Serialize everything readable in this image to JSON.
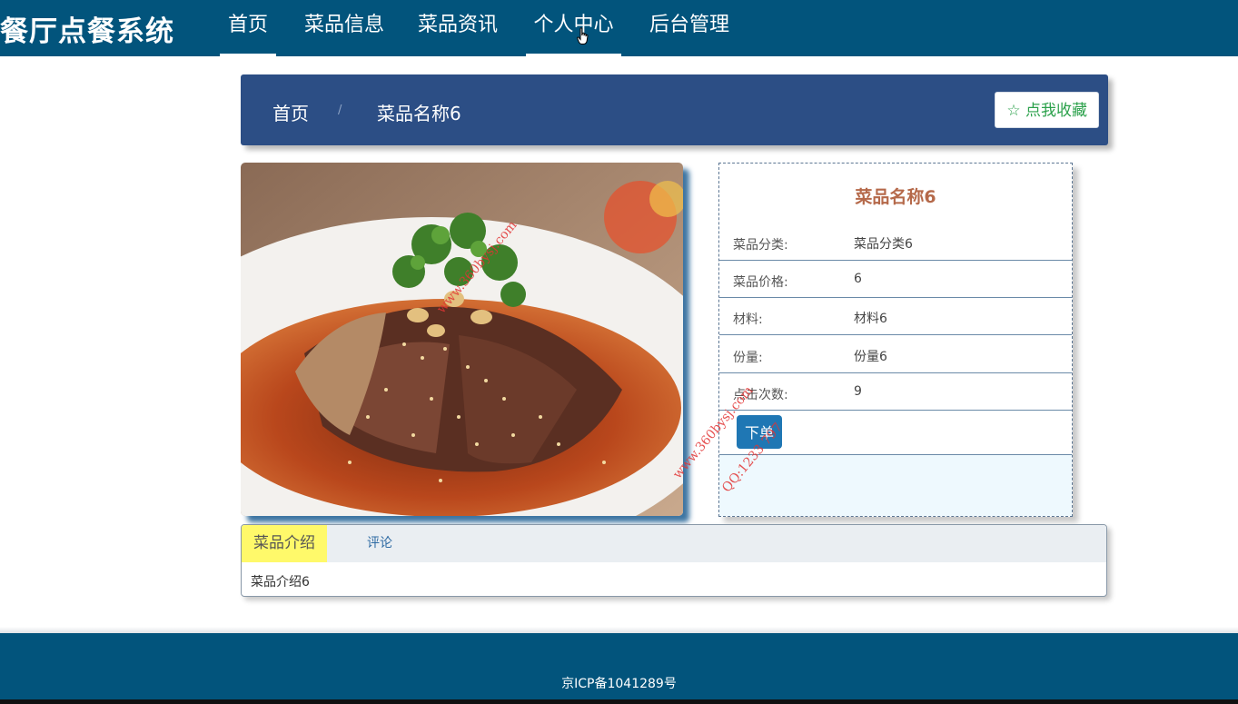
{
  "header": {
    "brand": "餐厅点餐系统",
    "nav": [
      {
        "label": "首页",
        "active": true
      },
      {
        "label": "菜品信息",
        "active": false
      },
      {
        "label": "菜品资讯",
        "active": false
      },
      {
        "label": "个人中心",
        "active": true
      },
      {
        "label": "后台管理",
        "active": false
      }
    ]
  },
  "breadcrumb": {
    "home": "首页",
    "separator": "/",
    "current": "菜品名称6",
    "favorite_icon": "star-outline-icon",
    "favorite_label": "☆ 点我收藏"
  },
  "dish": {
    "title": "菜品名称6",
    "fields": [
      {
        "label": "菜品分类:",
        "value": "菜品分类6"
      },
      {
        "label": "菜品价格:",
        "value": "6"
      },
      {
        "label": "材料:",
        "value": "材料6"
      },
      {
        "label": "份量:",
        "value": "份量6"
      },
      {
        "label": "点击次数:",
        "value": "9"
      }
    ],
    "order_label": "下单"
  },
  "watermark": {
    "site": "www.360bysj.com",
    "qq": "QQ:1233 797"
  },
  "tabs": {
    "items": [
      "菜品介绍",
      "评论"
    ],
    "content": "菜品介绍6"
  },
  "footer": {
    "icp": "京ICP备1041289号"
  },
  "colors": {
    "nav_bg": "#02547c",
    "crumb_bg": "#2c4e85",
    "title": "#b5694a",
    "order_button": "#1f77b4",
    "active_tab": "#fff96a",
    "favorite_text": "#2ba14b"
  }
}
